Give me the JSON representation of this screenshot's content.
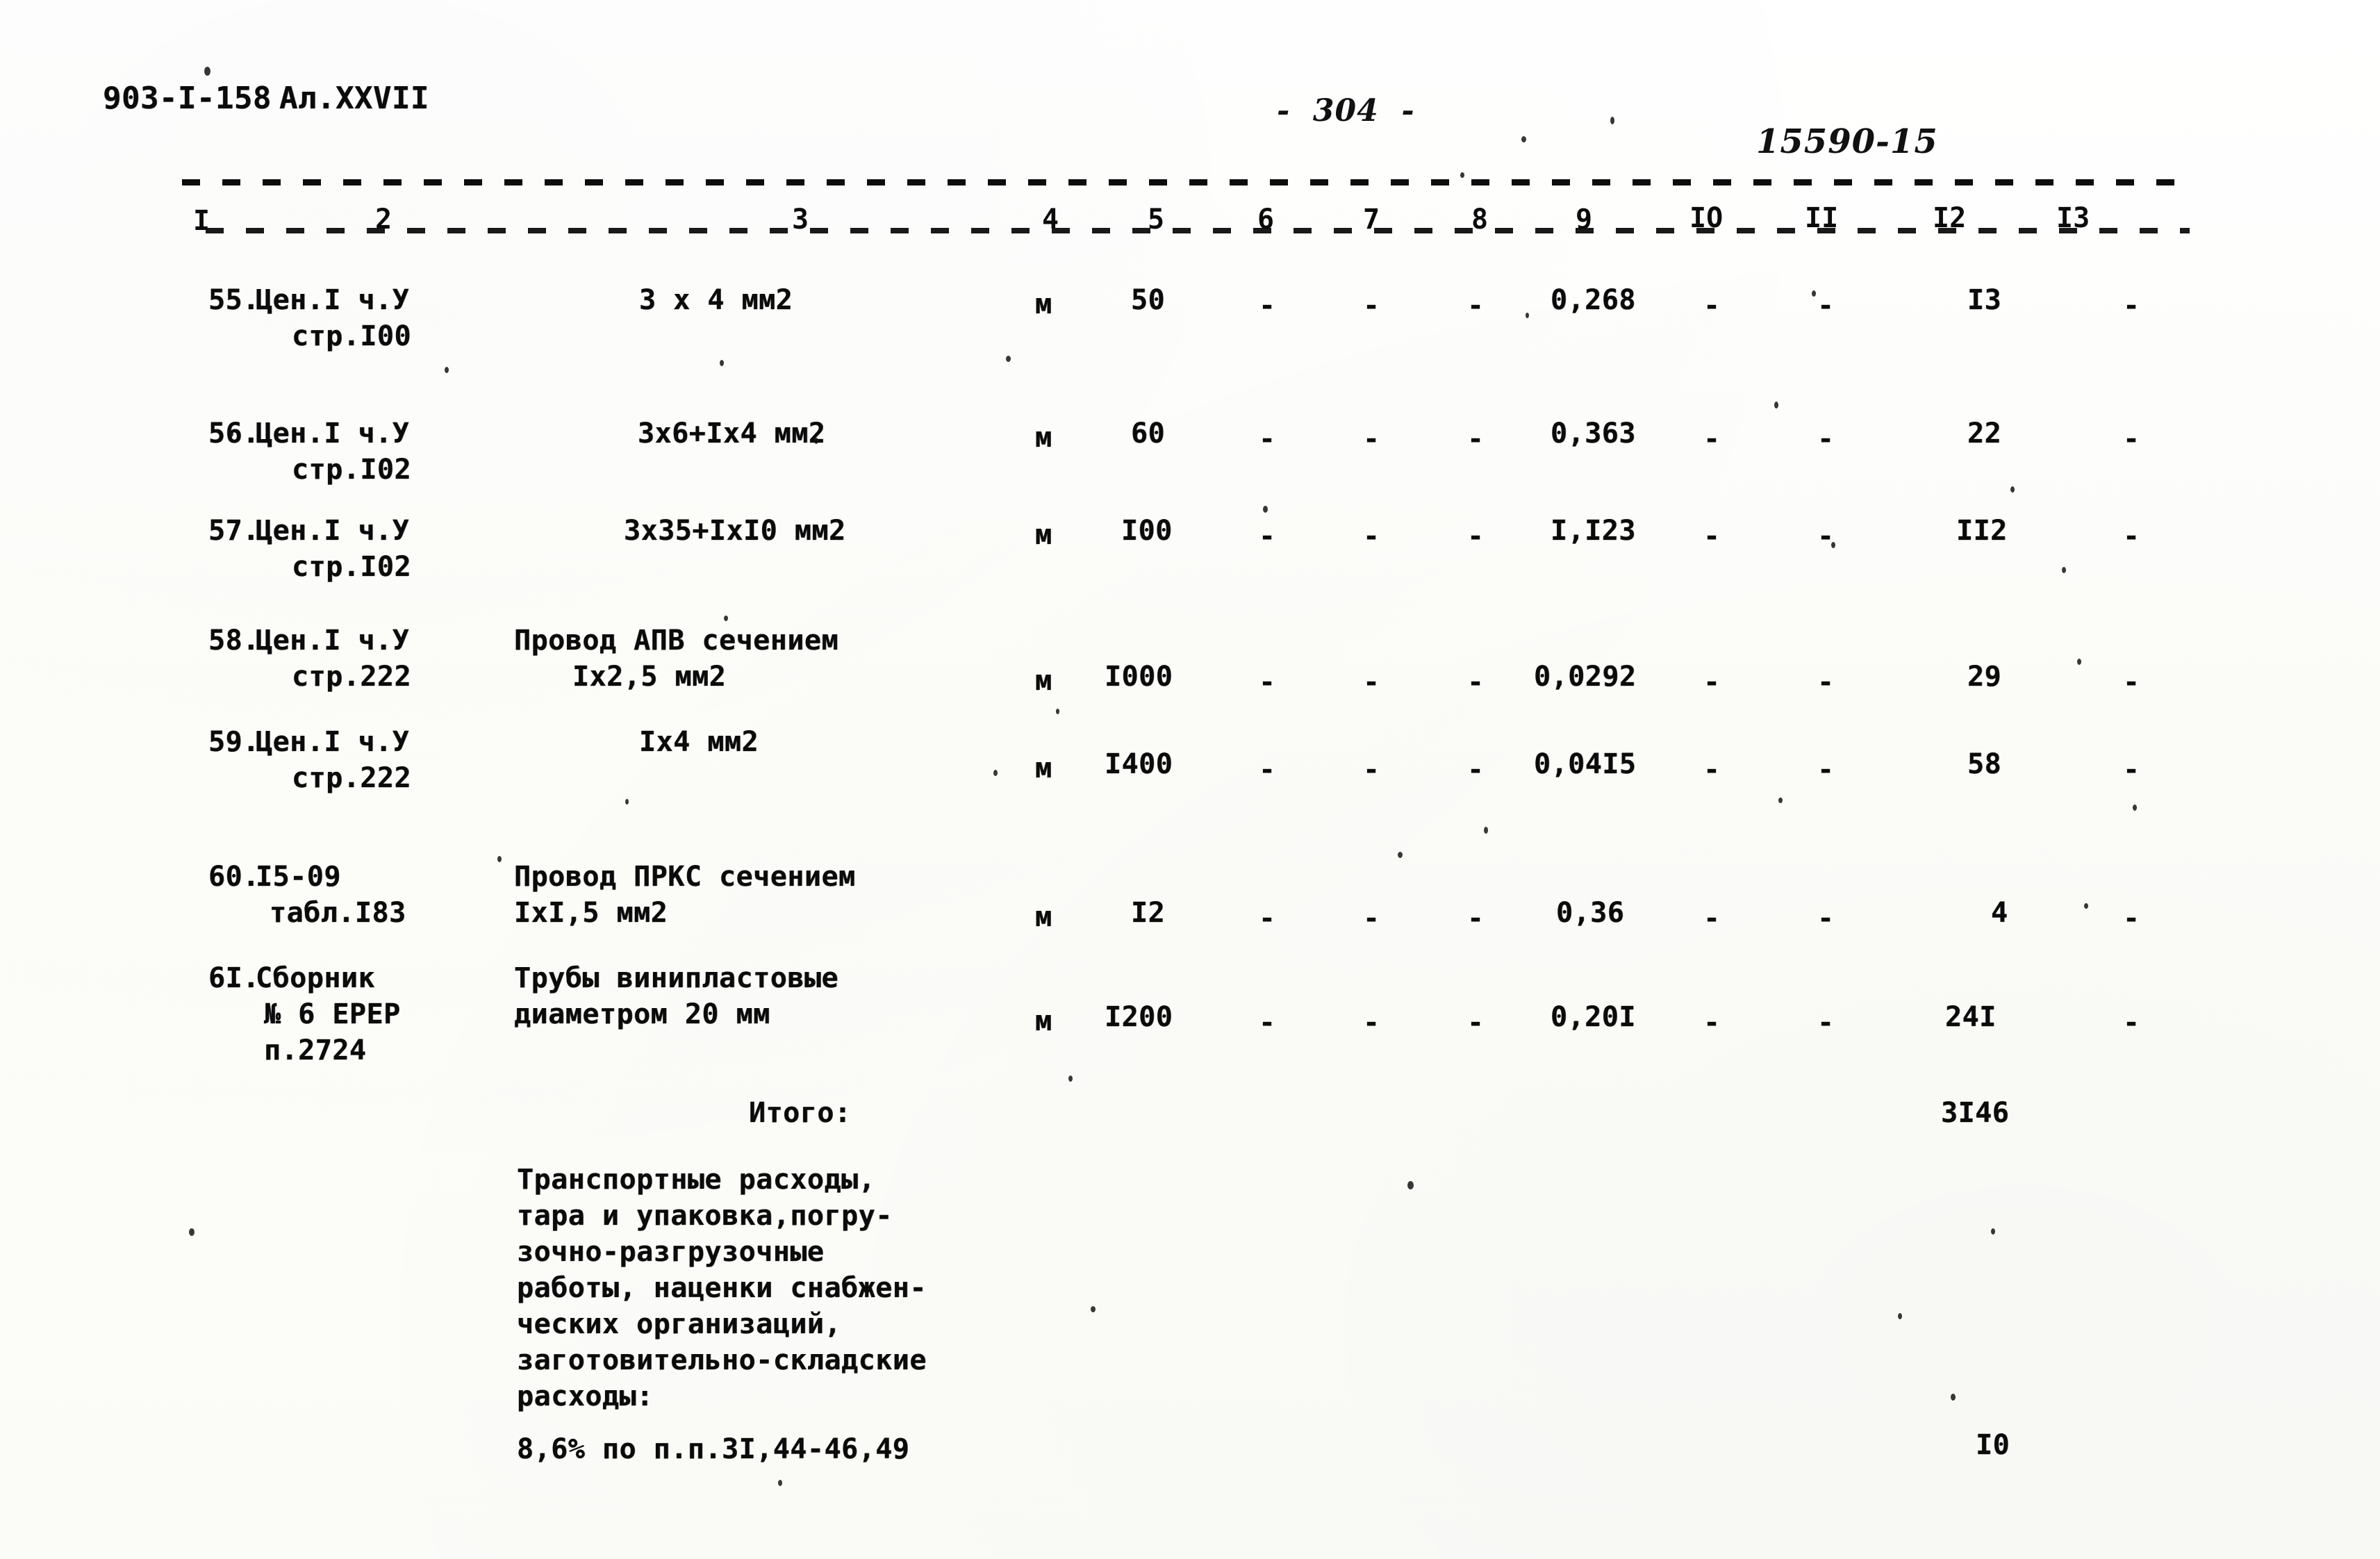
{
  "header": {
    "doc_code": "903-I-158",
    "album": "Ал.XXVII",
    "page_marker": "-  304  -",
    "handwritten_code": "15590-15"
  },
  "table": {
    "column_numbers": [
      "I",
      "2",
      "3",
      "4",
      "5",
      "6",
      "7",
      "8",
      "9",
      "IO",
      "II",
      "I2",
      "I3"
    ],
    "rows": [
      {
        "num": "55.",
        "source_line1": "Цен.I ч.У",
        "source_line2": "стр.I00",
        "desc_line1": "3 x 4 мм2",
        "desc_line2": "",
        "unit": "м",
        "qty": "50",
        "c6": "-",
        "c7": "-",
        "c8": "-",
        "price": "0,268",
        "c10": "-",
        "c11": "-",
        "total": "I3",
        "c13": "-"
      },
      {
        "num": "56.",
        "source_line1": "Цен.I ч.У",
        "source_line2": "стр.I02",
        "desc_line1": "3х6+Iх4 мм2",
        "desc_line2": "",
        "unit": "м",
        "qty": "60",
        "c6": "-",
        "c7": "-",
        "c8": "-",
        "price": "0,363",
        "c10": "-",
        "c11": "-",
        "total": "22",
        "c13": "-"
      },
      {
        "num": "57.",
        "source_line1": "Цен.I ч.У",
        "source_line2": "стр.I02",
        "desc_line1": "3х35+IхI0 мм2",
        "desc_line2": "",
        "unit": "м",
        "qty": "I00",
        "c6": "-",
        "c7": "-",
        "c8": "-",
        "price": "I,I23",
        "c10": "-",
        "c11": "-",
        "total": "II2",
        "c13": "-"
      },
      {
        "num": "58.",
        "source_line1": "Цен.I ч.У",
        "source_line2": "стр.222",
        "desc_line1": "Провод АПВ сечением",
        "desc_line2": "Iх2,5 мм2",
        "unit": "м",
        "qty": "I000",
        "c6": "-",
        "c7": "-",
        "c8": "-",
        "price": "0,0292",
        "c10": "-",
        "c11": "-",
        "total": "29",
        "c13": "-"
      },
      {
        "num": "59.",
        "source_line1": "Цен.I ч.У",
        "source_line2": "стр.222",
        "desc_line1": "Iх4 мм2",
        "desc_line2": "",
        "unit": "м",
        "qty": "I400",
        "c6": "-",
        "c7": "-",
        "c8": "-",
        "price": "0,04I5",
        "c10": "-",
        "c11": "-",
        "total": "58",
        "c13": "-"
      },
      {
        "num": "60.",
        "source_line1": "I5-09",
        "source_line2": "табл.I83",
        "desc_line1": "Провод ПРКС сечением",
        "desc_line2": "IхI,5 мм2",
        "unit": "м",
        "qty": "I2",
        "c6": "-",
        "c7": "-",
        "c8": "-",
        "price": "0,36",
        "c10": "-",
        "c11": "-",
        "total": "4",
        "c13": "-"
      },
      {
        "num": "6I.",
        "source_line1": "Сборник",
        "source_line2": "№ 6 ЕРЕР",
        "source_line3": "п.2724",
        "desc_line1": "Трубы винипластовые",
        "desc_line2": "диаметром 20 мм",
        "unit": "м",
        "qty": "I200",
        "c6": "-",
        "c7": "-",
        "c8": "-",
        "price": "0,20I",
        "c10": "-",
        "c11": "-",
        "total": "24I",
        "c13": "-"
      }
    ],
    "subtotal": {
      "label": "Итого:",
      "value": "3I46"
    }
  },
  "notes": {
    "paragraph_lines": [
      "Транспортные расходы,",
      "тара и упаковка,погру-",
      "зочно-разгрузочные",
      "работы, наценки снабжен-",
      "ческих организаций,",
      "заготовительно-складские",
      "расходы:"
    ],
    "percent_line": "8,6% по п.п.3I,44-46,49",
    "percent_value": "I0"
  }
}
